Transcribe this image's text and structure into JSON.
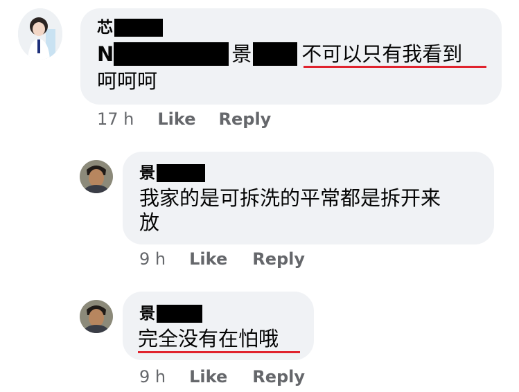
{
  "comments": [
    {
      "author_visible": "芯",
      "line1_prefix": "N",
      "line1_mid": "景",
      "line1_highlight": "不可以只有我看到",
      "line2": "呵呵呵",
      "time": "17 h",
      "like_label": "Like",
      "reply_label": "Reply"
    },
    {
      "author_visible": "景",
      "line1": "我家的是可拆洗的平常都是拆开来",
      "line2": "放",
      "time": "9 h",
      "like_label": "Like",
      "reply_label": "Reply"
    },
    {
      "author_visible": "景",
      "line1_highlight": "完全没有在怕哦",
      "time": "9 h",
      "like_label": "Like",
      "reply_label": "Reply"
    }
  ],
  "colors": {
    "bubble": "#f0f2f5",
    "meta_text": "#65676b",
    "underline": "#e0232e",
    "redaction": "#000000"
  },
  "icons": [
    "avatar-girl-icon",
    "avatar-boy-icon"
  ]
}
